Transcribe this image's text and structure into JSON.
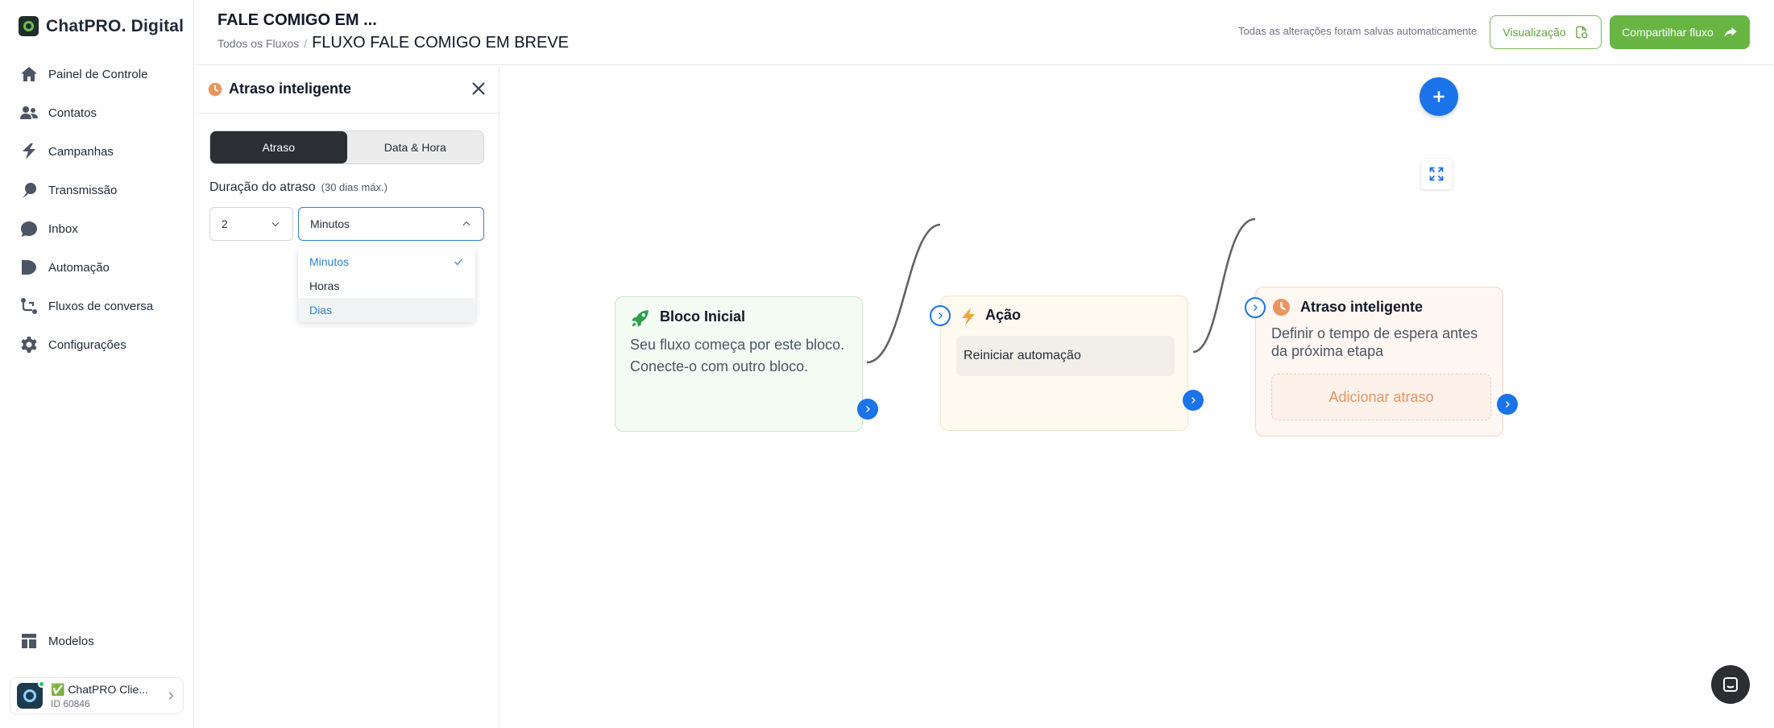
{
  "app": {
    "brand": "ChatPRO. Digital"
  },
  "sidebar": {
    "items": [
      {
        "label": "Painel de Controle",
        "icon": "home-icon"
      },
      {
        "label": "Contatos",
        "icon": "users-icon"
      },
      {
        "label": "Campanhas",
        "icon": "bolt-icon"
      },
      {
        "label": "Transmissão",
        "icon": "broadcast-icon"
      },
      {
        "label": "Inbox",
        "icon": "chat-bubble-icon"
      },
      {
        "label": "Automação",
        "icon": "automation-icon"
      },
      {
        "label": "Fluxos de conversa",
        "icon": "flow-icon"
      },
      {
        "label": "Configurações",
        "icon": "gear-icon"
      }
    ],
    "templates": {
      "label": "Modelos",
      "icon": "templates-icon"
    },
    "account": {
      "name": "✅ ChatPRO Clie...",
      "id": "ID 60846"
    }
  },
  "header": {
    "title": "FALE COMIGO EM ...",
    "breadcrumb_root": "Todos os Fluxos",
    "breadcrumb_sep": "/",
    "breadcrumb_current": "FLUXO FALE COMIGO EM BREVE",
    "save_status": "Todas as alterações foram salvas automaticamente",
    "preview_label": "Visualização",
    "share_label": "Compartilhar fluxo"
  },
  "panel": {
    "title": "Atraso inteligente",
    "tabs": [
      {
        "label": "Atraso",
        "active": true
      },
      {
        "label": "Data & Hora",
        "active": false
      }
    ],
    "duration_label": "Duração do atraso",
    "duration_hint": "(30 dias máx.)",
    "amount_value": "2",
    "unit_value": "Minutos",
    "unit_options": [
      {
        "label": "Minutos",
        "selected": true
      },
      {
        "label": "Horas",
        "selected": false
      },
      {
        "label": "Dias",
        "selected": false
      }
    ]
  },
  "canvas": {
    "nodes": [
      {
        "title": "Bloco Inicial",
        "description": "Seu fluxo começa por este bloco. Conecte-o com outro bloco.",
        "icon": "rocket-icon"
      },
      {
        "title": "Ação",
        "action": "Reiniciar automação",
        "icon": "lightning-icon"
      },
      {
        "title": "Atraso inteligente",
        "description": "Definir o tempo de espera antes da próxima etapa",
        "button": "Adicionar atraso",
        "icon": "clock-icon"
      }
    ]
  },
  "colors": {
    "brand_green": "#68b544",
    "accent_blue": "#1a73e8",
    "delay_orange": "#e8955f"
  }
}
